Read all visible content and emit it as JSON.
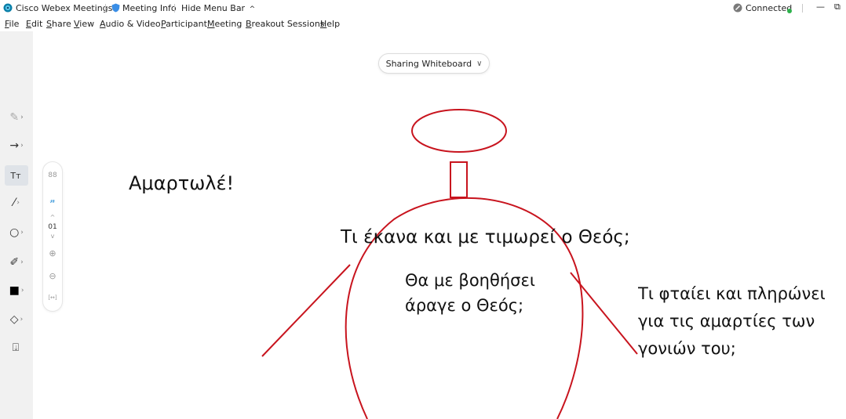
{
  "titlebar": {
    "app_title": "Cisco Webex Meetings",
    "meeting_info": "Meeting Info",
    "hide_menu": "Hide Menu Bar",
    "hide_menu_chevron": "^",
    "status": "Connected",
    "status_color": "#2db14b",
    "minimize_glyph": "—",
    "restore_glyph": "⧉"
  },
  "menubar": {
    "items": [
      {
        "u": "F",
        "rest": "ile"
      },
      {
        "u": "E",
        "rest": "dit"
      },
      {
        "u": "S",
        "rest": "hare"
      },
      {
        "u": "V",
        "rest": "iew"
      },
      {
        "u": "A",
        "rest": "udio & Video"
      },
      {
        "u": "P",
        "rest": "articipant"
      },
      {
        "u": "M",
        "rest": "eeting"
      },
      {
        "u": "B",
        "rest": "reakout Sessions"
      },
      {
        "u": "H",
        "rest": "elp"
      }
    ]
  },
  "share": {
    "label": "Sharing Whiteboard",
    "chevron": "∨"
  },
  "toolbar": {
    "tools": [
      {
        "name": "pen-tool",
        "glyph": "✎",
        "chev": "›"
      },
      {
        "name": "arrow-tool",
        "glyph": "→",
        "chev": "›"
      },
      {
        "name": "text-tool",
        "glyph": "Tт",
        "chev": ""
      },
      {
        "name": "line-tool",
        "glyph": "⁄",
        "chev": "›"
      },
      {
        "name": "shape-tool",
        "glyph": "○",
        "chev": "›"
      },
      {
        "name": "highlighter-tool",
        "glyph": "✐",
        "chev": "›"
      },
      {
        "name": "color-tool",
        "glyph": "■",
        "chev": "›"
      },
      {
        "name": "eraser-tool",
        "glyph": "◇",
        "chev": "›"
      },
      {
        "name": "save-tool",
        "glyph": "⍗",
        "chev": ""
      }
    ]
  },
  "palette": {
    "grid_glyph": "88",
    "script_glyph": "𝓃",
    "up_glyph": "^",
    "size_value": "01",
    "down_glyph": "v",
    "zoom_in_glyph": "⊕",
    "zoom_out_glyph": "⊖",
    "fit_glyph": "[↔]"
  },
  "whiteboard": {
    "stroke_color": "#c8141e",
    "text1": "Αμαρτωλέ!",
    "text2": "Τι έκανα και με τιμωρεί ο Θεός;",
    "text3_line1": "Θα με βοηθήσει",
    "text3_line2": "άραγε ο Θεός;",
    "text4_line1": "Τι φταίει και πληρώνει",
    "text4_line2": "για τις αμαρτίες των",
    "text4_line3": "γονιών του;"
  }
}
